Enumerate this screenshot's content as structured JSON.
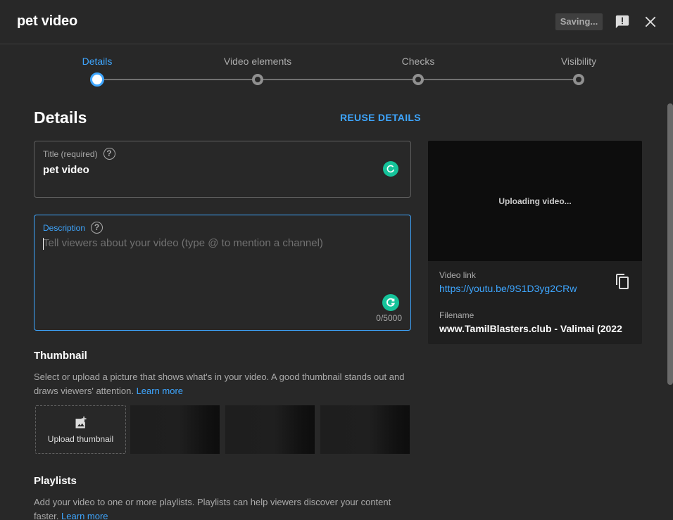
{
  "header": {
    "title": "pet video",
    "saving_label": "Saving...",
    "feedback_icon": "feedback-icon",
    "close_icon": "close-icon"
  },
  "stepper": {
    "steps": [
      {
        "label": "Details",
        "active": true
      },
      {
        "label": "Video elements",
        "active": false
      },
      {
        "label": "Checks",
        "active": false
      },
      {
        "label": "Visibility",
        "active": false
      }
    ]
  },
  "details": {
    "heading": "Details",
    "reuse_label": "REUSE DETAILS",
    "title_field": {
      "label": "Title (required)",
      "value": "pet video"
    },
    "description_field": {
      "label": "Description",
      "placeholder": "Tell viewers about your video (type @ to mention a channel)",
      "counter": "0/5000"
    }
  },
  "thumbnail": {
    "heading": "Thumbnail",
    "text": "Select or upload a picture that shows what's in your video. A good thumbnail stands out and draws viewers' attention.",
    "learn_more": "Learn more",
    "upload_label": "Upload thumbnail"
  },
  "playlists": {
    "heading": "Playlists",
    "text": "Add your video to one or more playlists. Playlists can help viewers discover your content faster.",
    "learn_more": "Learn more"
  },
  "preview": {
    "status": "Uploading video...",
    "video_link_label": "Video link",
    "video_link": "https://youtu.be/9S1D3yg2CRw",
    "filename_label": "Filename",
    "filename": "www.TamilBlasters.club - Valimai (2022"
  },
  "colors": {
    "accent": "#3ea6ff",
    "background": "#282828",
    "grammarly": "#15c39a"
  }
}
